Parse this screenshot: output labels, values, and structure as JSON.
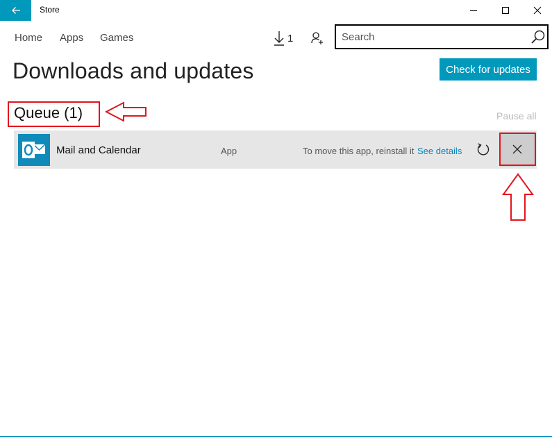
{
  "window": {
    "title": "Store",
    "accent_color": "#0099bc",
    "back_icon": "back-arrow-icon",
    "controls": [
      "minimize-icon",
      "maximize-icon",
      "close-icon"
    ]
  },
  "nav": {
    "items": [
      {
        "label": "Home"
      },
      {
        "label": "Apps"
      },
      {
        "label": "Games"
      }
    ],
    "downloads_count": "1",
    "downloads_icon": "download-arrow-icon",
    "user_icon": "add-user-icon"
  },
  "search": {
    "placeholder": "Search",
    "value": ""
  },
  "page": {
    "title": "Downloads and updates",
    "check_button": "Check for updates"
  },
  "queue": {
    "title": "Queue (1)",
    "pause_all": "Pause all",
    "items": [
      {
        "name": "Mail and Calendar",
        "type": "App",
        "status": "To move this app, reinstall it",
        "link": "See details",
        "icon": "outlook-mail-icon",
        "icon_color": "#0f8ab9",
        "actions": [
          "retry-icon",
          "cancel-icon"
        ]
      }
    ]
  },
  "annotations": {
    "color": "#e3141d",
    "marks": [
      "queue-highlight-box",
      "left-pointing-arrow",
      "cancel-highlight-box",
      "up-pointing-arrow"
    ]
  }
}
